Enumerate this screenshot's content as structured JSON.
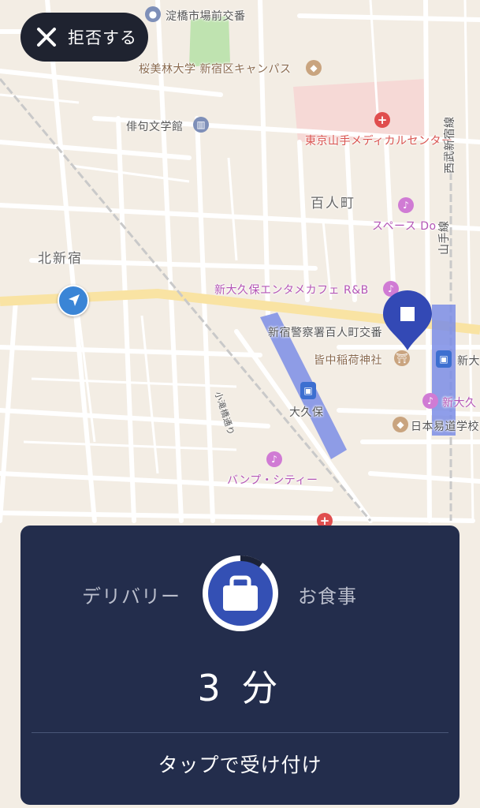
{
  "map": {
    "labels": {
      "yodobashi": "淀橋市場前交番",
      "obirin": "桜美林大学 新宿区キャンパス",
      "haiku": "俳句文学館",
      "yamate_med": "東京山手メディカルセンター",
      "seibu": "西武新宿線",
      "hyakunin": "百人町",
      "space_do": "スペース Do",
      "kita_shinjuku": "北新宿",
      "shinokubo_cafe": "新大久保エンタメカフェ R&B",
      "police": "新宿警察署百人町交番",
      "yamanote": "山手線",
      "minaka": "皆中稲荷神社",
      "shin_edge": "新大",
      "shin_okubo_edge": "新大久",
      "okubo": "大久保",
      "nihon_yido": "日本易道学校",
      "otaki": "小滝橋通り",
      "bump": "バンプ・シティー"
    }
  },
  "reject": {
    "label": "拒否する"
  },
  "order_card": {
    "service_left": "デリバリー",
    "service_right": "お食事",
    "eta": "3 分",
    "accept_label": "タップで受け付け",
    "timer_remaining_fraction": 0.9
  },
  "colors": {
    "card_bg": "#232d4c",
    "timer_blue": "#3450b4",
    "pin_blue": "#3349b5",
    "reject_bg": "#1f2330"
  }
}
